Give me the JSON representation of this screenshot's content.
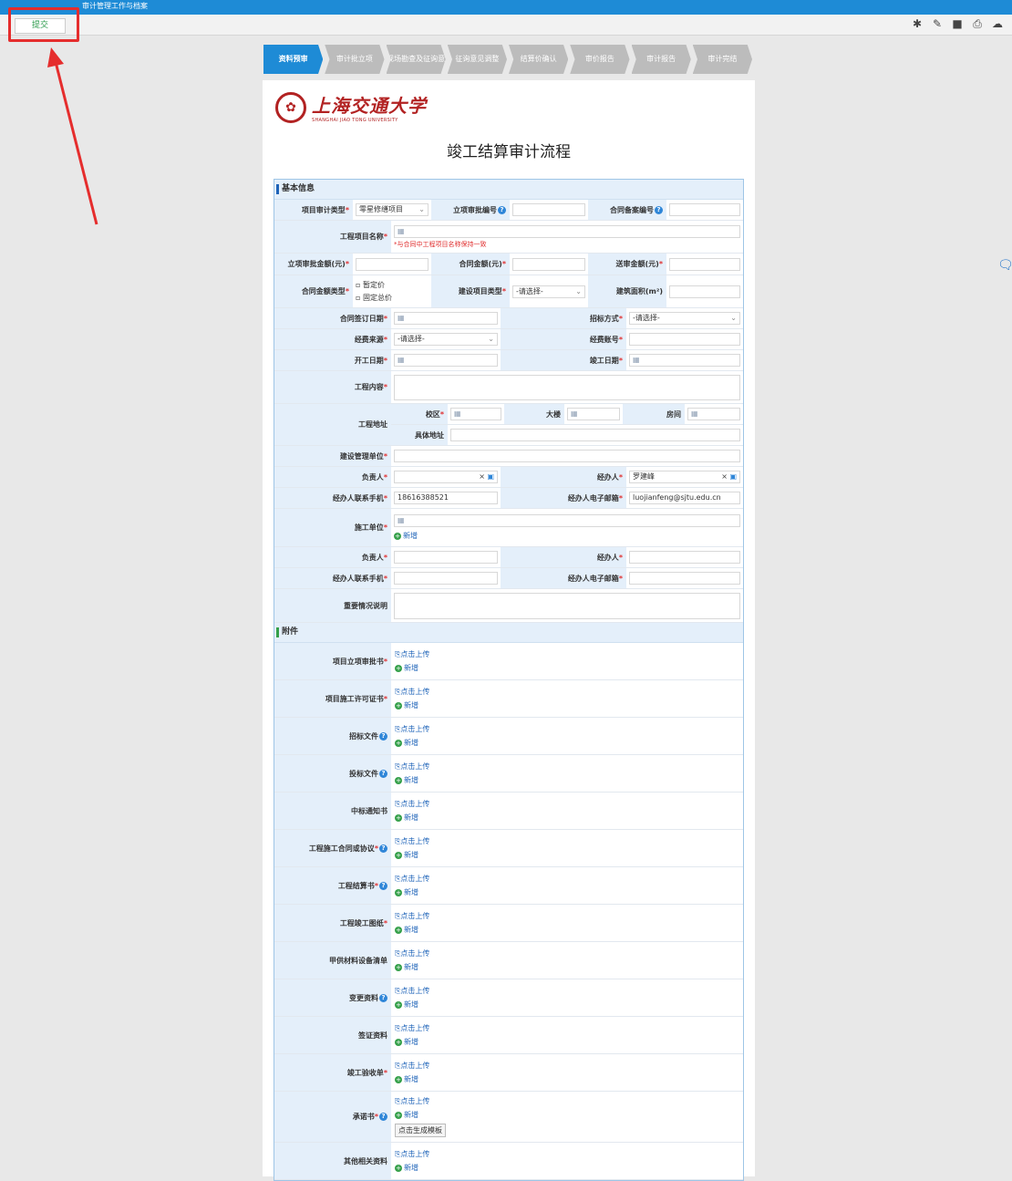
{
  "window": {
    "title": "审计管理工作与档案"
  },
  "toolbar": {
    "submit_label": "提交",
    "icons": [
      "bug-icon",
      "edit-icon",
      "save-icon",
      "print-icon",
      "cloud-icon"
    ]
  },
  "colors": {
    "header_blue": "#1e8bd6",
    "highlight_red": "#e52d2d",
    "required_red": "#e03030"
  },
  "steps": [
    "资料预审",
    "审计批立项",
    "现场勘查及征询意见",
    "征询意见调整",
    "结算价确认",
    "审价报告",
    "审计报告",
    "审计完结"
  ],
  "university": {
    "name_cn": "上海交通大学",
    "name_en": "SHANGHAI JIAO TONG UNIVERSITY"
  },
  "page_title": "竣工结算审计流程",
  "basic": {
    "section": "基本信息",
    "audit_type_label": "项目审计类型",
    "audit_type_value": "零星修缮项目",
    "approval_no_label": "立项审批编号",
    "contract_filing_label": "合同备案编号",
    "project_name_label": "工程项目名称",
    "project_name_hint": "*与合同中工程项目名称保持一致",
    "approval_amount_label": "立项审批金额(元)",
    "contract_amount_label": "合同金额(元)",
    "submit_amount_label": "送审金额(元)",
    "contract_type_label": "合同金额类型",
    "contract_type_opt1": "暂定价",
    "contract_type_opt2": "固定总价",
    "build_type_label": "建设项目类型",
    "placeholder_select": "-请选择-",
    "area_label": "建筑面积(m²)",
    "sign_date_label": "合同签订日期",
    "bid_method_label": "招标方式",
    "fund_source_label": "经费来源",
    "fund_account_label": "经费账号",
    "start_date_label": "开工日期",
    "finish_date_label": "竣工日期",
    "content_label": "工程内容",
    "address_label": "工程地址",
    "campus_label": "校区",
    "building_label": "大楼",
    "room_label": "房间",
    "detail_addr_label": "具体地址",
    "mgmt_unit_label": "建设管理单位",
    "head_label": "负责人",
    "handler_label": "经办人",
    "handler_value": "罗建峰",
    "handler_phone_label": "经办人联系手机",
    "handler_phone_value": "18616388521",
    "handler_email_label": "经办人电子邮箱",
    "handler_email_value": "luojianfeng@sjtu.edu.cn",
    "constructor_label": "施工单位",
    "add_label": "新增",
    "notes_label": "重要情况说明"
  },
  "attachments": {
    "section": "附件",
    "upload_label": "点击上传",
    "add_label": "新增",
    "template_label": "点击生成模板",
    "items": [
      {
        "label": "项目立项审批书",
        "req": "*",
        "help": ""
      },
      {
        "label": "项目施工许可证书",
        "req": "*",
        "help": ""
      },
      {
        "label": "招标文件",
        "req": "",
        "help": "?"
      },
      {
        "label": "投标文件",
        "req": "",
        "help": "?"
      },
      {
        "label": "中标通知书",
        "req": "",
        "help": ""
      },
      {
        "label": "工程施工合同或协议",
        "req": "*",
        "help": "?"
      },
      {
        "label": "工程结算书",
        "req": "*",
        "help": "?"
      },
      {
        "label": "工程竣工图纸",
        "req": "*",
        "help": ""
      },
      {
        "label": "甲供材料设备清单",
        "req": "",
        "help": ""
      },
      {
        "label": "变更资料",
        "req": "",
        "help": "?"
      },
      {
        "label": "签证资料",
        "req": "",
        "help": ""
      },
      {
        "label": "竣工验收单",
        "req": "*",
        "help": ""
      },
      {
        "label": "承诺书",
        "req": "*",
        "help": "?"
      },
      {
        "label": "其他相关资料",
        "req": "",
        "help": ""
      }
    ]
  }
}
